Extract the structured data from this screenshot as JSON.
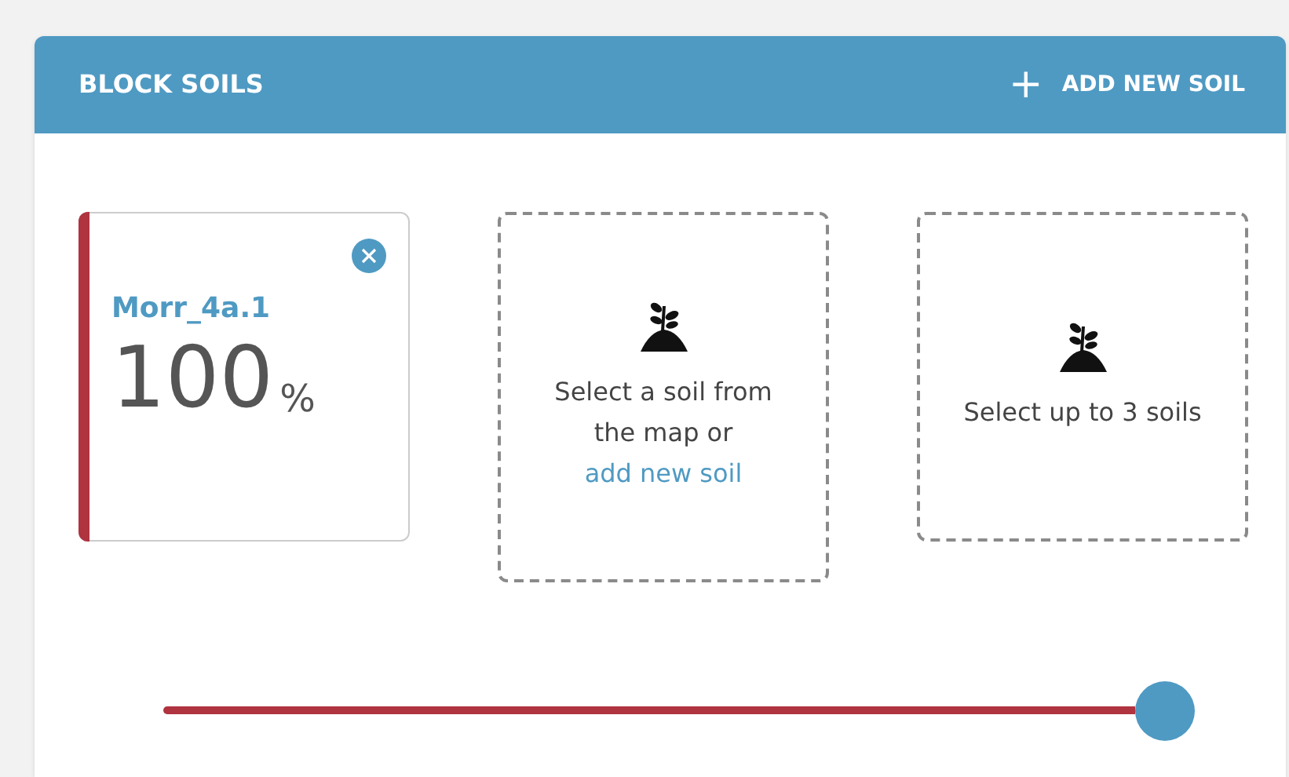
{
  "panel": {
    "title": "BLOCK SOILS",
    "action": {
      "icon": "+",
      "label": "ADD NEW SOIL"
    }
  },
  "soils": [
    {
      "name": "Morr_4a.1",
      "percent": "100",
      "unit": "%",
      "color": "#b03340"
    }
  ],
  "slots": [
    {
      "kind": "link",
      "text": "Select a soil from the map or",
      "link": "add new soil"
    },
    {
      "kind": "plain",
      "text": "Select up to 3 soils"
    }
  ],
  "slider": {
    "level": 1
  }
}
